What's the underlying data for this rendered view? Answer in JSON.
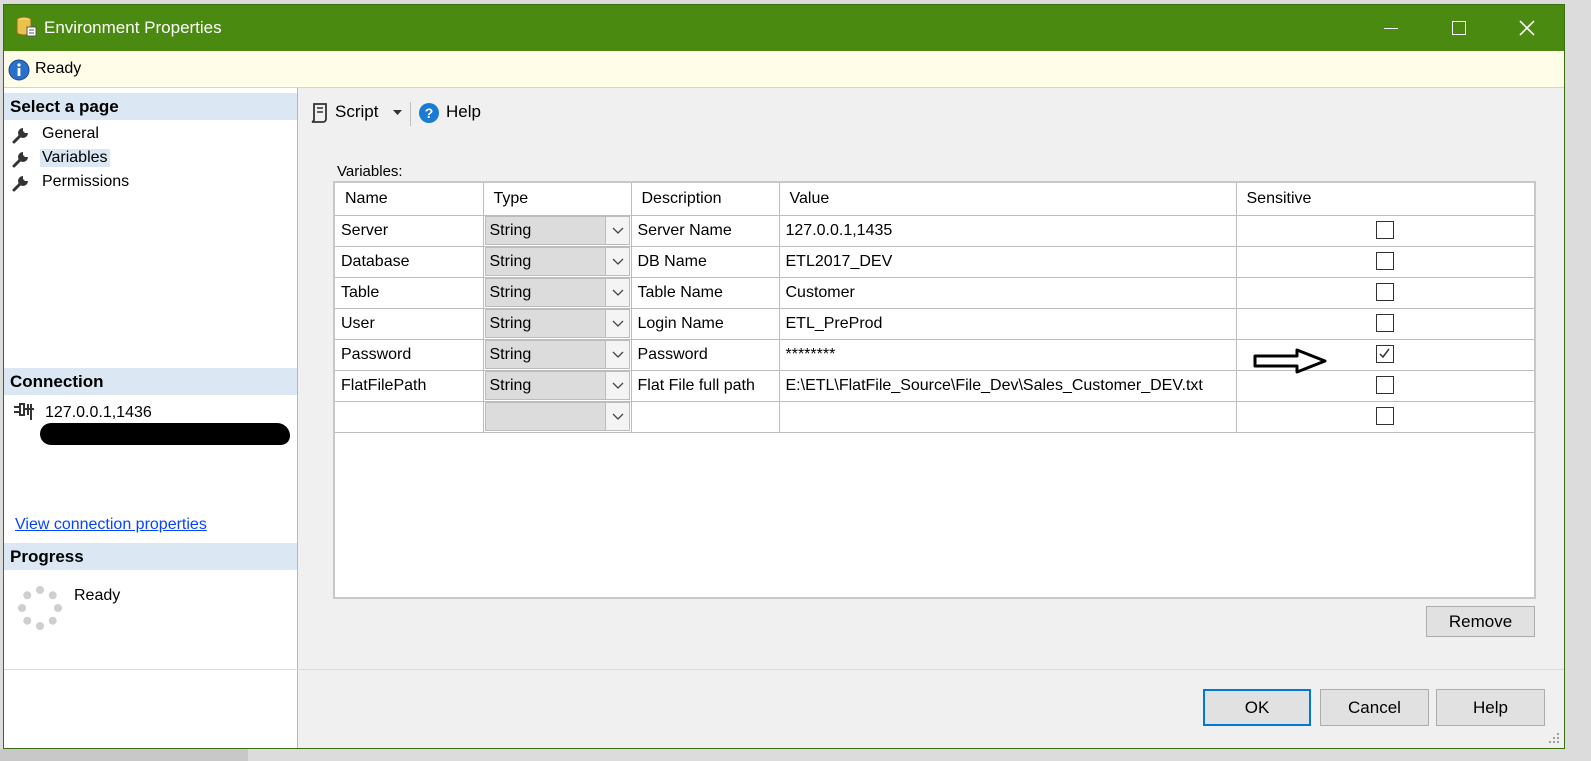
{
  "window": {
    "title": "Environment Properties"
  },
  "status": {
    "text": "Ready"
  },
  "sidebar": {
    "select_page_header": "Select a page",
    "pages": [
      {
        "label": "General",
        "selected": false
      },
      {
        "label": "Variables",
        "selected": true
      },
      {
        "label": "Permissions",
        "selected": false
      }
    ],
    "connection_header": "Connection",
    "connection_server": "127.0.0.1,1436",
    "view_connection_link": "View connection properties",
    "progress_header": "Progress",
    "progress_status": "Ready"
  },
  "toolbar": {
    "script_label": "Script",
    "help_label": "Help"
  },
  "variables": {
    "label": "Variables:",
    "columns": [
      "Name",
      "Type",
      "Description",
      "Value",
      "Sensitive"
    ],
    "rows": [
      {
        "name": "Server",
        "type": "String",
        "description": "Server Name",
        "value": "127.0.0.1,1435",
        "sensitive": false
      },
      {
        "name": "Database",
        "type": "String",
        "description": "DB Name",
        "value": "ETL2017_DEV",
        "sensitive": false
      },
      {
        "name": "Table",
        "type": "String",
        "description": "Table Name",
        "value": "Customer",
        "sensitive": false
      },
      {
        "name": "User",
        "type": "String",
        "description": "Login Name",
        "value": "ETL_PreProd",
        "sensitive": false
      },
      {
        "name": "Password",
        "type": "String",
        "description": "Password",
        "value": "********",
        "sensitive": true
      },
      {
        "name": "FlatFilePath",
        "type": "String",
        "description": "Flat File full path",
        "value": "E:\\ETL\\FlatFile_Source\\File_Dev\\Sales_Customer_DEV.txt",
        "sensitive": false
      },
      {
        "name": "",
        "type": "",
        "description": "",
        "value": "",
        "sensitive": false
      }
    ]
  },
  "buttons": {
    "remove": "Remove",
    "ok": "OK",
    "cancel": "Cancel",
    "help": "Help"
  },
  "colors": {
    "titlebar": "#4a8a10",
    "status_bg": "#fffde8",
    "section_header": "#dbe7f3",
    "link": "#0645ff",
    "default_button_border": "#0078d7"
  }
}
